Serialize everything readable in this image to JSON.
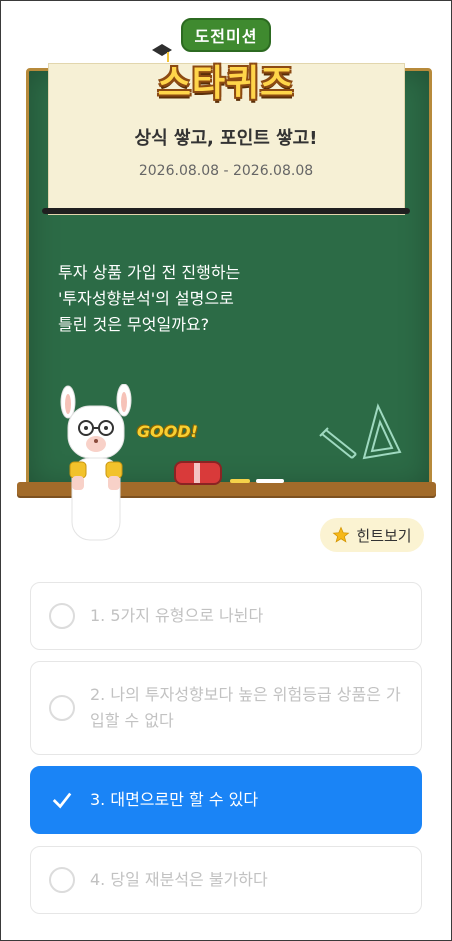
{
  "logo": {
    "sub": "도전미션",
    "main": "스타퀴즈"
  },
  "event": {
    "title": "상식 쌓고, 포인트 쌓고!",
    "date": "2026.08.08 - 2026.08.08"
  },
  "question": {
    "line1": "투자 상품 가입 전 진행하는",
    "line2": "'투자성향분석'의 설명으로",
    "line3": "틀린 것은 무엇일까요?"
  },
  "decor": {
    "good_text": "GOOD!"
  },
  "hint": {
    "label": "힌트보기"
  },
  "options": [
    {
      "label": "1. 5가지 유형으로 나뉜다",
      "selected": false
    },
    {
      "label": "2. 나의 투자성향보다 높은 위험등급 상품은 가입할 수 없다",
      "selected": false
    },
    {
      "label": "3. 대면으로만 할 수 있다",
      "selected": true
    },
    {
      "label": "4. 당일 재분석은 불가하다",
      "selected": false
    }
  ],
  "colors": {
    "board": "#2c6b46",
    "frame": "#b78a3b",
    "selected": "#1a84f6",
    "hint_bg": "#fbf3d2"
  }
}
